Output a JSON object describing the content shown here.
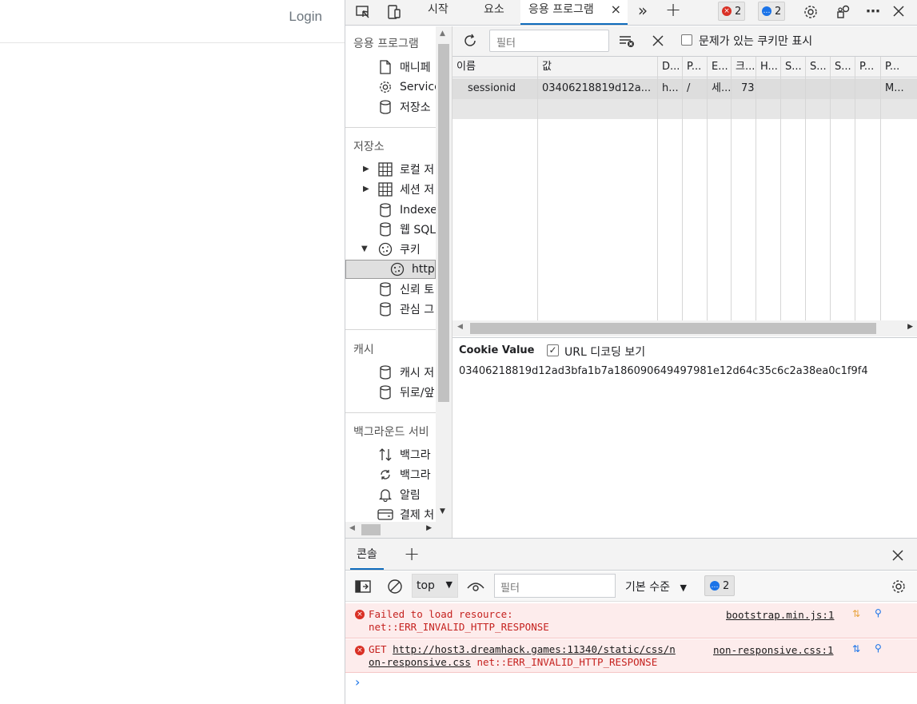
{
  "webpage": {
    "login_label": "Login"
  },
  "devtools": {
    "tabs": [
      {
        "label": "시작"
      },
      {
        "label": "요소"
      },
      {
        "label": "응용 프로그램",
        "active": true
      }
    ],
    "close_tab_glyph": "×",
    "more_tabs_glyph": "»",
    "add_tab_glyph": "+",
    "error_count": "2",
    "message_count": "2",
    "icons": [
      "inspect-icon",
      "device-icon",
      "gear-icon",
      "customize-icon",
      "more-icon",
      "close-icon"
    ]
  },
  "sidebar": {
    "sections": [
      {
        "title": "응용 프로그램",
        "items": [
          {
            "label": "매니페",
            "icon": "file-icon"
          },
          {
            "label": "Service",
            "icon": "gear-icon"
          },
          {
            "label": "저장소",
            "icon": "database-icon"
          }
        ]
      },
      {
        "title": "저장소",
        "items": [
          {
            "label": "로컬 저",
            "icon": "grid-icon",
            "expandable": true
          },
          {
            "label": "세션 저",
            "icon": "grid-icon",
            "expandable": true
          },
          {
            "label": "Indexed",
            "icon": "database-icon"
          },
          {
            "label": "웹 SQL",
            "icon": "database-icon"
          },
          {
            "label": "쿠키",
            "icon": "cookie-icon",
            "expanded": true
          },
          {
            "label": "http:",
            "icon": "cookie-icon",
            "selected": true
          },
          {
            "label": "신뢰 토",
            "icon": "database-icon"
          },
          {
            "label": "관심 그",
            "icon": "database-icon"
          }
        ]
      },
      {
        "title": "캐시",
        "items": [
          {
            "label": "캐시 저",
            "icon": "database-icon"
          },
          {
            "label": "뒤로/앞",
            "icon": "database-icon"
          }
        ]
      },
      {
        "title": "백그라운드 서비",
        "items": [
          {
            "label": "백그라",
            "icon": "updown-arrows-icon"
          },
          {
            "label": "백그라",
            "icon": "sync-icon"
          },
          {
            "label": "알림",
            "icon": "bell-icon"
          },
          {
            "label": "결제 처",
            "icon": "card-icon"
          }
        ]
      }
    ]
  },
  "cookies": {
    "filter_placeholder": "필터",
    "only_issues_label": "문제가 있는 쿠키만 표시",
    "columns": [
      "이름",
      "값",
      "D...",
      "P...",
      "E...",
      "크...",
      "H...",
      "S...",
      "S...",
      "S...",
      "P...",
      "P..."
    ],
    "rows": [
      [
        "sessionid",
        "03406218819d12a...",
        "h...",
        "/",
        "세...",
        "73",
        "",
        "",
        "",
        "",
        "",
        "M..."
      ]
    ],
    "value_panel": {
      "title": "Cookie Value",
      "url_decode_label": "URL 디코딩 보기",
      "url_decode_checked": true,
      "check_glyph": "✓",
      "value": "03406218819d12ad3bfa1b7a186090649497981e12d64c35c6c2a38ea0c1f9f4"
    }
  },
  "console": {
    "tab_label": "콘솔",
    "context": "top",
    "filter_placeholder": "필터",
    "level_label": "기본 수준",
    "message_count": "2",
    "messages": [
      {
        "text1": "Failed to load resource:",
        "text2": "net::ERR_INVALID_HTTP_RESPONSE",
        "source": "bootstrap.min.js:1"
      },
      {
        "prefix": "GET",
        "url1": "http://host3.dreamhack.games:11340/static/css/n",
        "url2": "on-responsive.css",
        "suffix": "net::ERR_INVALID_HTTP_RESPONSE",
        "source": "non-responsive.css:1"
      }
    ],
    "prompt": "›"
  }
}
